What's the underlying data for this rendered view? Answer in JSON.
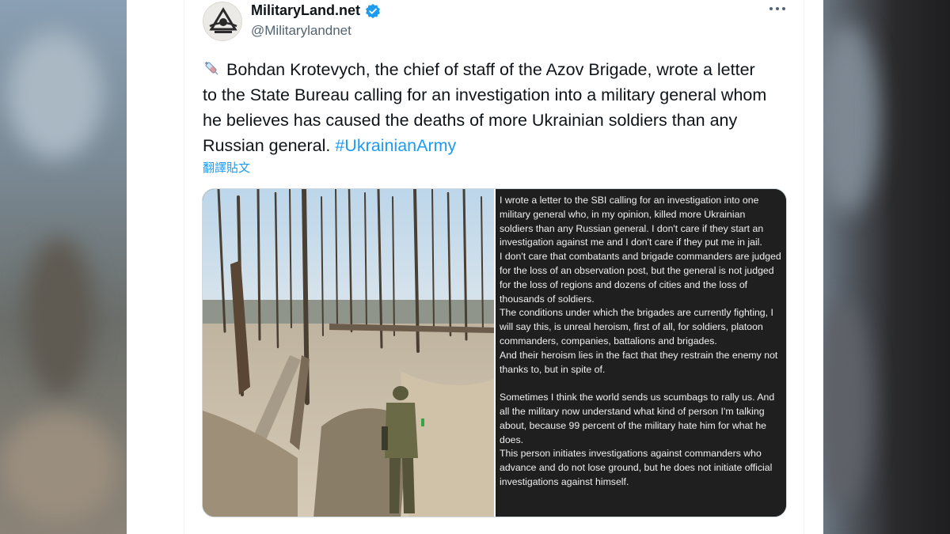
{
  "tweet": {
    "display_name": "MilitaryLand.net",
    "handle": "@Militarylandnet",
    "text": "Bohdan Krotevych, the chief of staff of the Azov Brigade, wrote a letter to the State Bureau calling for an investigation into a military general whom he believes has caused the deaths of more Ukrainian soldiers than any Russian general.",
    "hashtag": "#UkrainianArmy",
    "translate_label": "翻譯貼文",
    "icons": {
      "avatar": "militaryland-logo",
      "verified": "verified-badge-icon",
      "more": "more-options-icon",
      "emoji": "syringe-icon"
    }
  },
  "letter": {
    "paragraphs": [
      "I wrote a letter to the SBI calling for an investigation into one military general who, in my opinion, killed more Ukrainian soldiers than any Russian general. I don't care if they start an investigation against me and I don't care if they put me in jail.",
      "I don't care that combatants and brigade commanders are judged for the loss of an observation post, but the general is not judged for the loss of regions and dozens of cities and the loss of thousands of soldiers.",
      "The conditions under which the brigades are currently fighting, I will say this, is unreal heroism, first of all, for soldiers, platoon commanders, companies, battalions and brigades.",
      "And their heroism lies in the fact that they restrain the enemy not thanks to, but in spite of.",
      "",
      "Sometimes I think the world sends us scumbags to rally us. And all the military now understand what kind of person I'm talking about, because 99 percent of the military hate him for what he does.",
      "This person initiates investigations against commanders who advance and do not lose ground, but he does not initiate official investigations against himself."
    ]
  },
  "colors": {
    "link": "#1d9bf0",
    "text": "#0f1419",
    "secondary": "#536471",
    "letter_bg": "#1f1f1f"
  }
}
